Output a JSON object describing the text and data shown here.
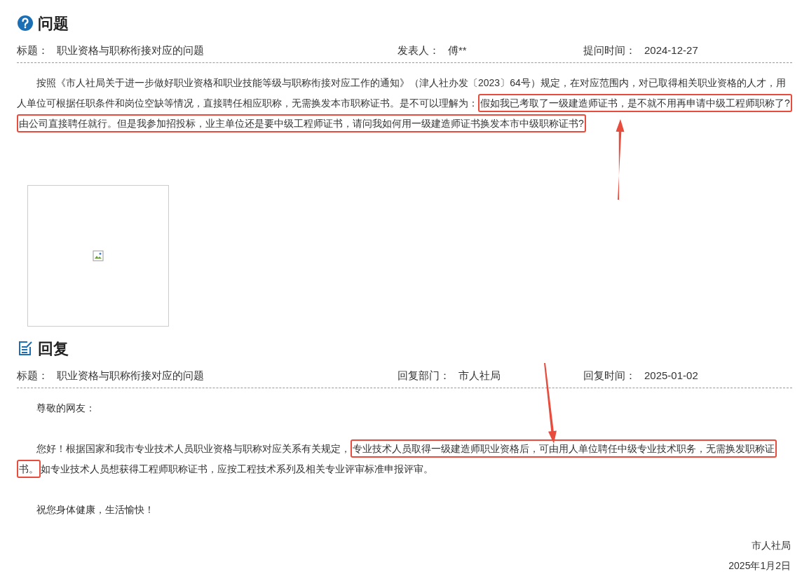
{
  "question": {
    "heading": "问题",
    "meta": [
      {
        "label": "标题：",
        "value": "职业资格与职称衔接对应的问题"
      },
      {
        "label": "发表人：",
        "value": "傅**"
      },
      {
        "label": "提问时间：",
        "value": "2024-12-27"
      }
    ],
    "paragraphs": [
      [
        {
          "text": "按照《市人社局关于进一步做好职业资格和职业技能等级与职称衔接对应工作的通知》（津人社办发〔2023〕64号）规定，在对应范围内，对已取得相关职业资格的人才，用人单位可根据任职条件和岗位空缺等情况，直接聘任相应职称，无需换发本市职称证书。是不可以理解为：",
          "highlighted": false
        },
        {
          "text": "假如我已考取了一级建造师证书，是不就不用再申请中级工程师职称了?由公司直接聘任就行。但是我参加招投标，业主单位还是要中级工程师证书，请问我如何用一级建造师证书换发本市中级职称证书?",
          "highlighted": true
        }
      ]
    ],
    "attachment": {
      "kind": "broken-image"
    }
  },
  "reply": {
    "heading": "回复",
    "meta": [
      {
        "label": "标题：",
        "value": "职业资格与职称衔接对应的问题"
      },
      {
        "label": "回复部门：",
        "value": "市人社局"
      },
      {
        "label": "回复时间：",
        "value": "2025-01-02"
      }
    ],
    "paragraphs": [
      [
        {
          "text": "尊敬的网友：",
          "highlighted": false
        }
      ],
      [
        {
          "text": "您好！根据国家和我市专业技术人员职业资格与职称对应关系有关规定，",
          "highlighted": false
        },
        {
          "text": "专业技术人员取得一级建造师职业资格后，可由用人单位聘任中级专业技术职务，无需换发职称证书。",
          "highlighted": true
        },
        {
          "text": "如专业技术人员想获得工程师职称证书，应按工程技术系列及相关专业评审标准申报评审。",
          "highlighted": false
        }
      ],
      [
        {
          "text": "祝您身体健康，生活愉快！",
          "highlighted": false
        }
      ]
    ],
    "signature": [
      "市人社局",
      "2025年1月2日"
    ]
  }
}
